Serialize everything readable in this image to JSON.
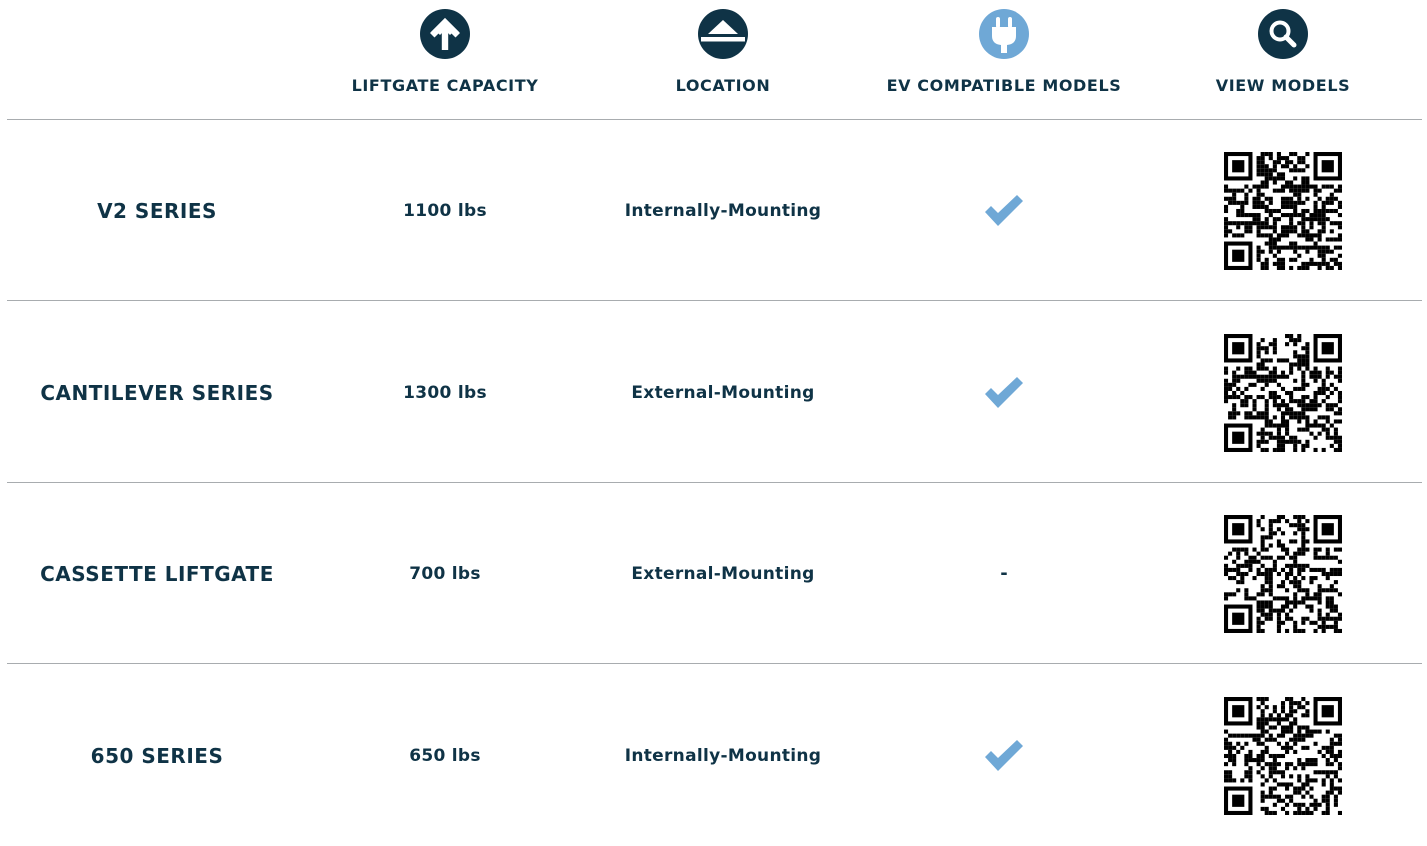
{
  "header": {
    "columns": [
      {
        "label": "LIFTGATE CAPACITY",
        "icon": "arrow-up-circle-icon"
      },
      {
        "label": "LOCATION",
        "icon": "eject-circle-icon"
      },
      {
        "label": "EV COMPATIBLE MODELS",
        "icon": "plug-icon"
      },
      {
        "label": "VIEW MODELS",
        "icon": "search-icon"
      }
    ]
  },
  "colors": {
    "navy": "#0f3346",
    "ev_blue": "#6fa8d6",
    "rule": "#a8acaf"
  },
  "rows": [
    {
      "series": "V2 SERIES",
      "capacity": "1100 lbs",
      "location": "Internally-Mounting",
      "ev": "check",
      "qr": "qr-code-icon"
    },
    {
      "series": "CANTILEVER SERIES",
      "capacity": "1300 lbs",
      "location": "External-Mounting",
      "ev": "check",
      "qr": "qr-code-icon"
    },
    {
      "series": "CASSETTE LIFTGATE",
      "capacity": "700 lbs",
      "location": "External-Mounting",
      "ev": "-",
      "qr": "qr-code-icon"
    },
    {
      "series": "650 SERIES",
      "capacity": "650 lbs",
      "location": "Internally-Mounting",
      "ev": "check",
      "qr": "qr-code-icon"
    }
  ]
}
